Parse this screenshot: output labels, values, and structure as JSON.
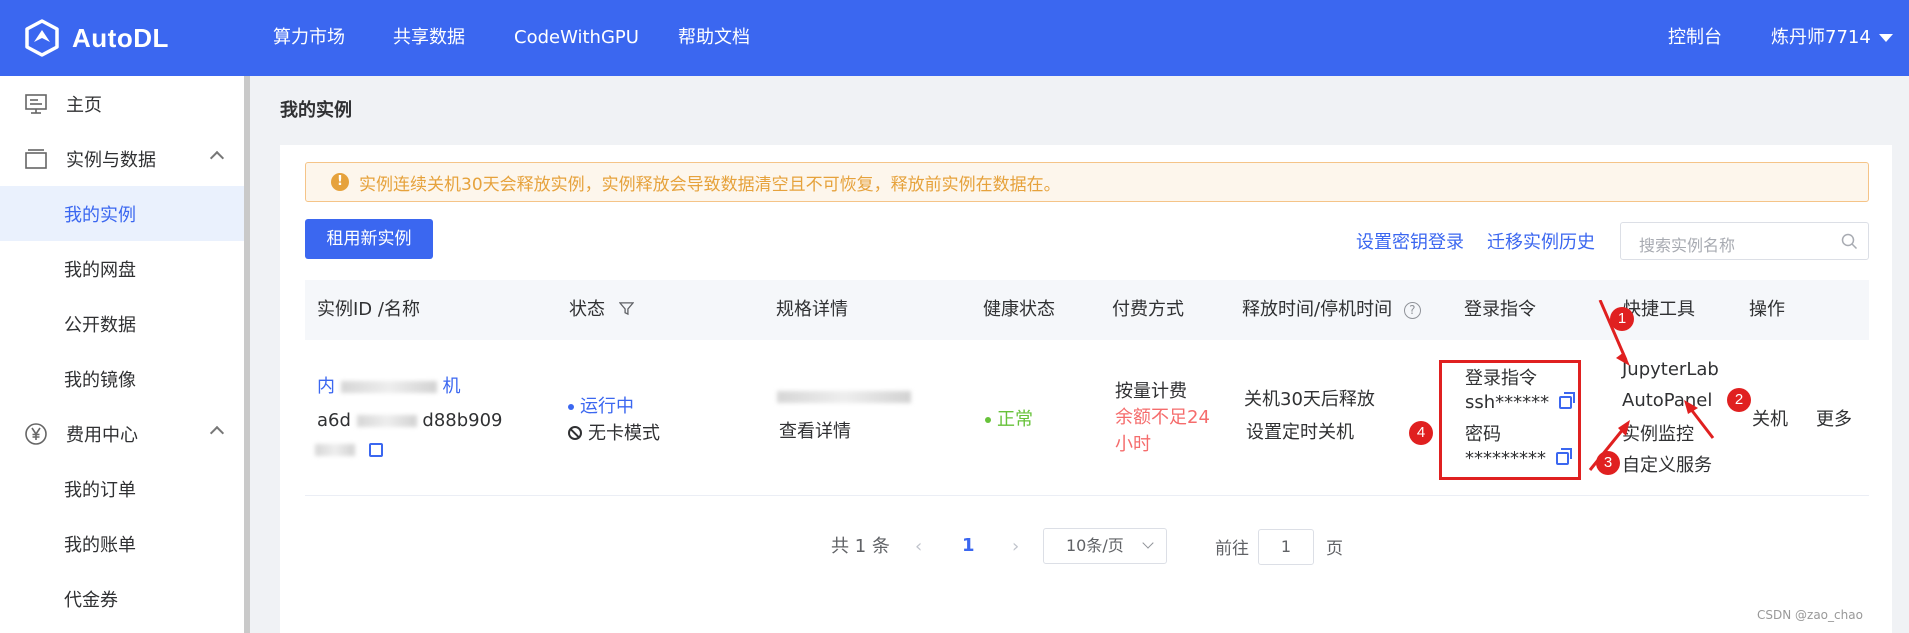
{
  "brand": {
    "name": "AutoDL",
    "color": "#3b67f0"
  },
  "topnav": [
    "算力市场",
    "共享数据",
    "CodeWithGPU",
    "帮助文档"
  ],
  "header_right": {
    "console": "控制台",
    "user": "炼丹师7714"
  },
  "sidebar": {
    "items": [
      {
        "label": "主页",
        "icon": "monitor-icon",
        "type": "top"
      },
      {
        "label": "实例与数据",
        "icon": "window-icon",
        "type": "group"
      },
      {
        "label": "我的实例",
        "type": "sub",
        "active": true
      },
      {
        "label": "我的网盘",
        "type": "sub"
      },
      {
        "label": "公开数据",
        "type": "sub"
      },
      {
        "label": "我的镜像",
        "type": "sub"
      },
      {
        "label": "费用中心",
        "icon": "yen-icon",
        "type": "group"
      },
      {
        "label": "我的订单",
        "type": "sub"
      },
      {
        "label": "我的账单",
        "type": "sub"
      },
      {
        "label": "代金券",
        "type": "sub"
      }
    ]
  },
  "page": {
    "title": "我的实例",
    "alert": "实例连续关机30天会释放实例，实例释放会导致数据清空且不可恢复，释放前实例在数据在。",
    "rent_button": "租用新实例",
    "set_key_login": "设置密钥登录",
    "migrate_history": "迁移实例历史",
    "search_placeholder": "搜索实例名称"
  },
  "table": {
    "headers": [
      "实例ID /名称",
      "状态",
      "规格详情",
      "健康状态",
      "付费方式",
      "释放时间/停机时间",
      "登录指令",
      "快捷工具",
      "操作"
    ],
    "row": {
      "name_partial": "内",
      "name_tail": "机",
      "id_partial": "a6d",
      "id_tail": "d88b909",
      "status": "运行中",
      "mode": "无卡模式",
      "spec_link": "查看详情",
      "health": "正常",
      "pay_method": "按量计费",
      "pay_warning": "余额不足24小时",
      "release": "关机30天后释放",
      "set_timer": "设置定时关机",
      "login_label": "登录指令",
      "login_value": "ssh******",
      "password_label": "密码",
      "password_value": "*********",
      "tools": [
        "JupyterLab",
        "AutoPanel",
        "实例监控",
        "自定义服务"
      ],
      "actions": [
        "关机",
        "更多"
      ]
    }
  },
  "annotations": [
    "1",
    "2",
    "3",
    "4"
  ],
  "pagination": {
    "total": "共 1 条",
    "current": "1",
    "page_size": "10条/页",
    "goto_label": "前往",
    "goto_value": "1",
    "page_suffix": "页"
  },
  "watermark": "CSDN @zao_chao"
}
